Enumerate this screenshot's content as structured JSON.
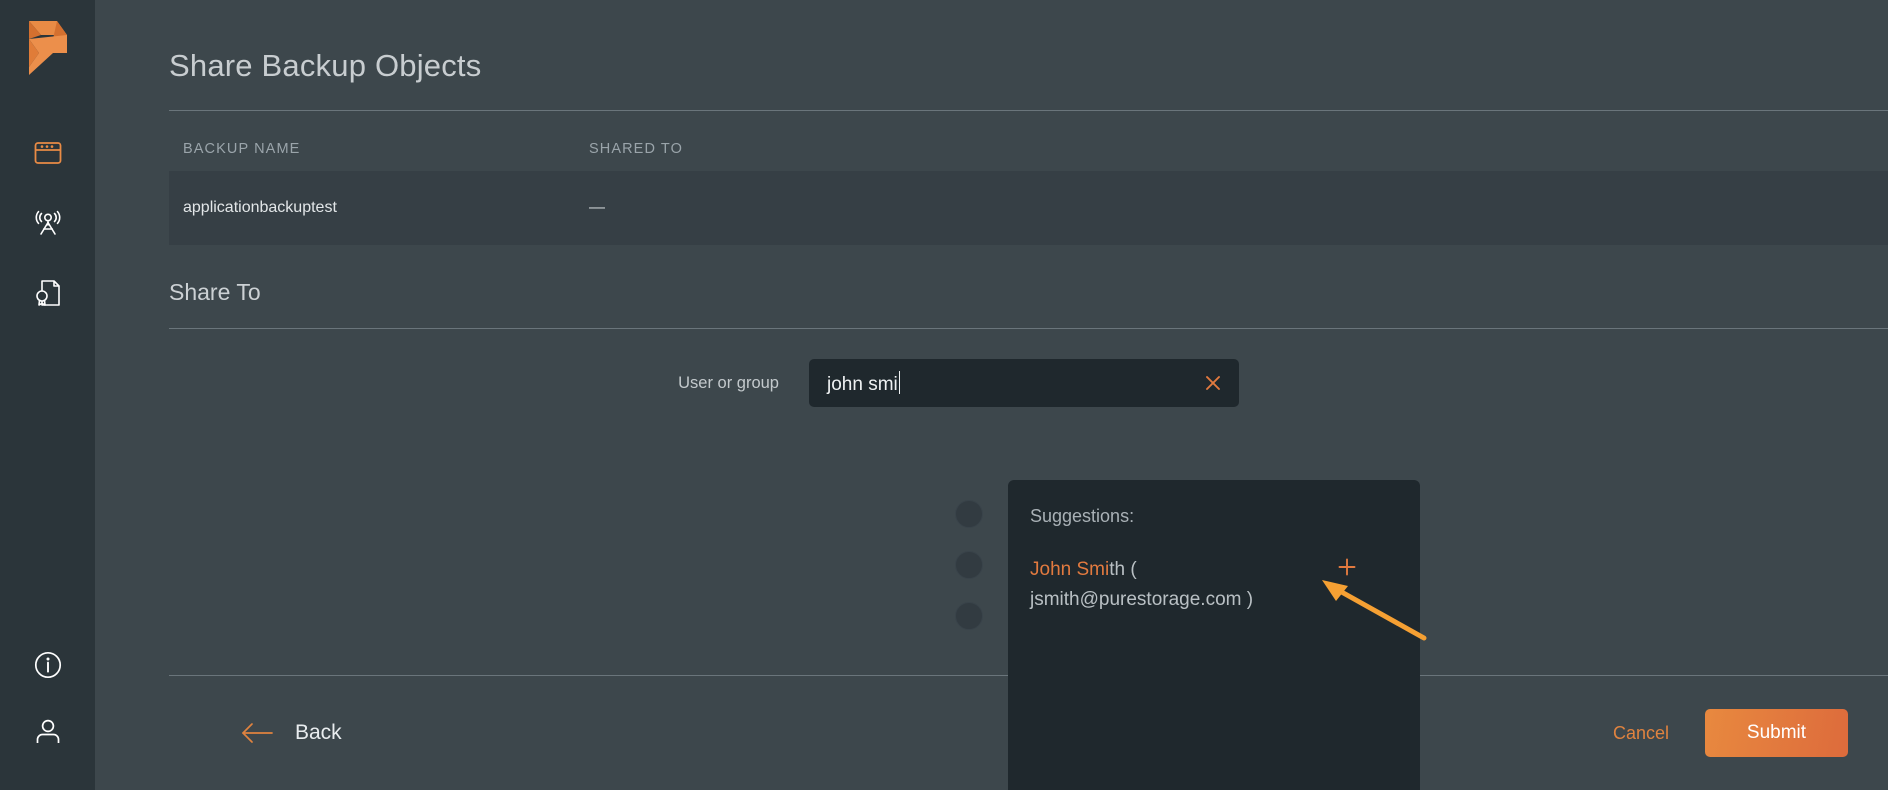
{
  "colors": {
    "accent": "#e27a3f",
    "accent_bright": "#f5a033",
    "sidebar_bg": "#2b353a",
    "main_bg": "#3d474c",
    "row_bg": "#363f45",
    "field_bg": "#1f282d",
    "text_primary": "#e2e6e8",
    "text_muted": "#9aa4aa",
    "rule": "#6a757b"
  },
  "sidebar": {
    "logo": "pure-storage-logo",
    "top_items": [
      {
        "icon": "dashboard-window-icon",
        "name": "dashboard"
      },
      {
        "icon": "antenna-broadcast-icon",
        "name": "fleet"
      },
      {
        "icon": "document-badge-icon",
        "name": "certificates"
      }
    ],
    "bottom_items": [
      {
        "icon": "info-circle-icon",
        "name": "help"
      },
      {
        "icon": "user-person-icon",
        "name": "account"
      }
    ]
  },
  "header": {
    "title": "Share Backup Objects"
  },
  "table": {
    "columns": [
      "BACKUP NAME",
      "SHARED TO"
    ],
    "rows": [
      {
        "backup_name": "applicationbackuptest",
        "shared_to": "—"
      }
    ]
  },
  "share_to": {
    "title": "Share To",
    "field_label": "User or group",
    "field_value": "john smi",
    "field_placeholder": "",
    "clear_icon": "close-x-icon"
  },
  "suggestions": {
    "label": "Suggestions:",
    "items": [
      {
        "match_text": "John Smi",
        "rest_text": "th ( jsmith@purestorage.com )",
        "full_text": "John Smith ( jsmith@purestorage.com )",
        "add_icon": "plus-icon"
      }
    ]
  },
  "radios": {
    "count": 3
  },
  "footer": {
    "back_label": "Back",
    "back_icon": "arrow-left-icon",
    "cancel_label": "Cancel",
    "submit_label": "Submit"
  }
}
